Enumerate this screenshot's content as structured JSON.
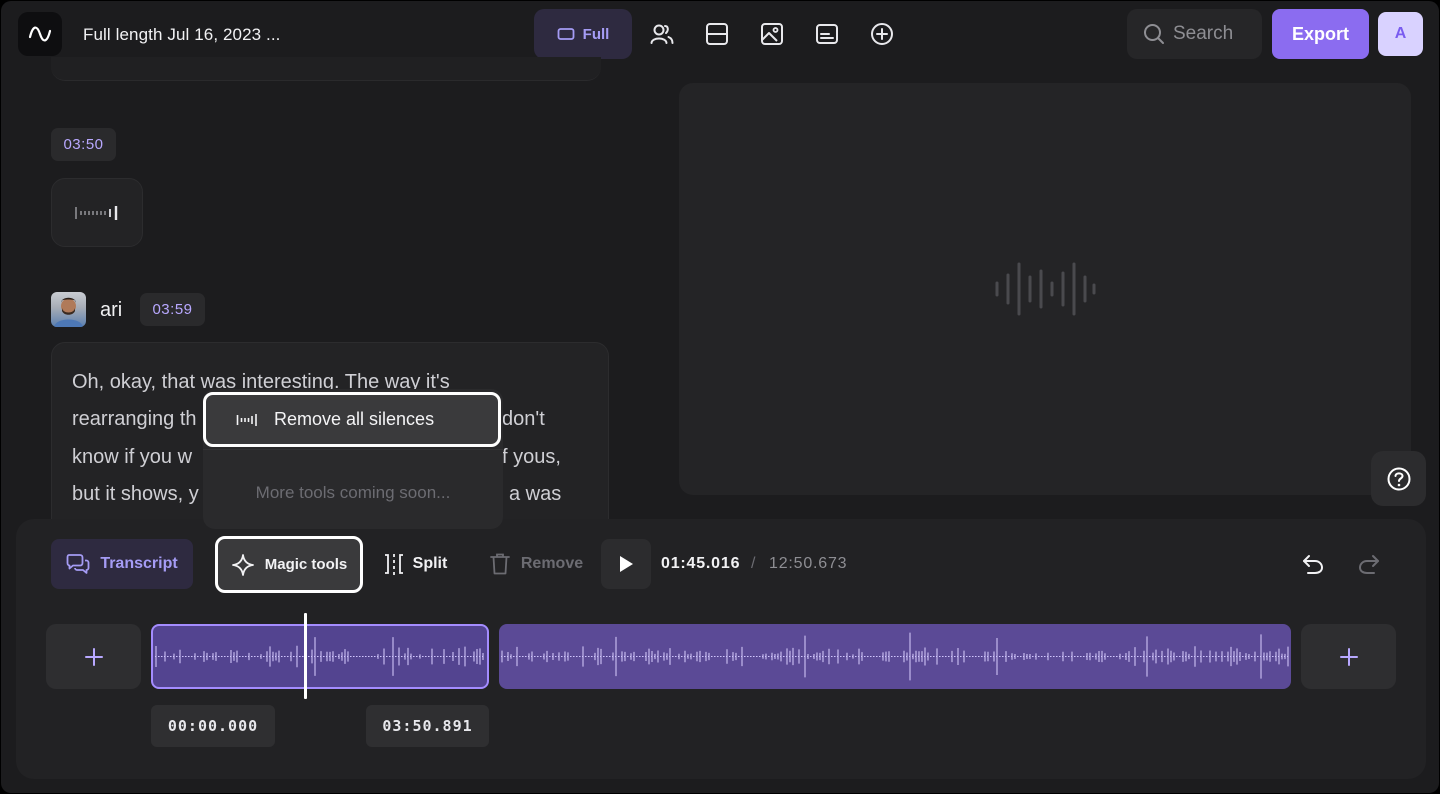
{
  "header": {
    "title": "Full length Jul 16, 2023 ...",
    "view_full_label": "Full",
    "search_placeholder": "Search",
    "export_label": "Export",
    "avatar_initial": "A"
  },
  "transcript": {
    "silence_timestamp": "03:50",
    "speaker_name": "ari",
    "speaker_timestamp": "03:59",
    "lines": [
      "Oh, okay, that was interesting. The way it's",
      "rearranging th",
      "don't",
      "know if you w",
      "f yous,",
      "but it shows, y",
      "a was"
    ]
  },
  "magic_menu": {
    "remove_silences_label": "Remove all silences",
    "coming_soon_label": "More tools coming soon..."
  },
  "toolbar": {
    "transcript_label": "Transcript",
    "magic_tools_label": "Magic tools",
    "split_label": "Split",
    "remove_label": "Remove",
    "current_time": "01:45.016",
    "separator": "/",
    "total_time": "12:50.673"
  },
  "timeline": {
    "clip1_start": "00:00.000",
    "clip1_end": "03:50.891"
  },
  "colors": {
    "accent": "#8b6cf0",
    "accent_text": "#a59cf5",
    "clip": "#5b4a96"
  }
}
